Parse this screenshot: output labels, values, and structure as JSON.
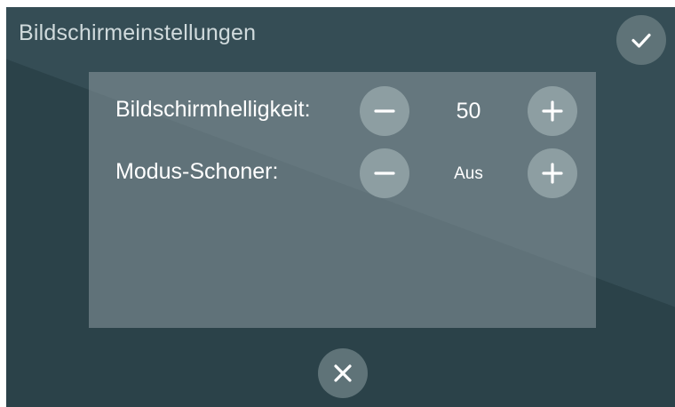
{
  "screen": {
    "title": "Bildschirmeinstellungen"
  },
  "settings": [
    {
      "label": "Bildschirmhelligkeit:",
      "value": "50"
    },
    {
      "label": "Modus-Schoner:",
      "value": "Aus"
    }
  ],
  "icons": {
    "confirm": "checkmark-icon",
    "cancel": "close-icon",
    "decrease": "minus-icon",
    "increase": "plus-icon"
  },
  "colors": {
    "background": "#2b4249",
    "background_diagonal": "#354d55",
    "panel": "#6f8187",
    "button": "#8d9ea2",
    "round_action_button": "#5f7378",
    "text": "#ffffff",
    "title_text": "#d0dadc"
  }
}
